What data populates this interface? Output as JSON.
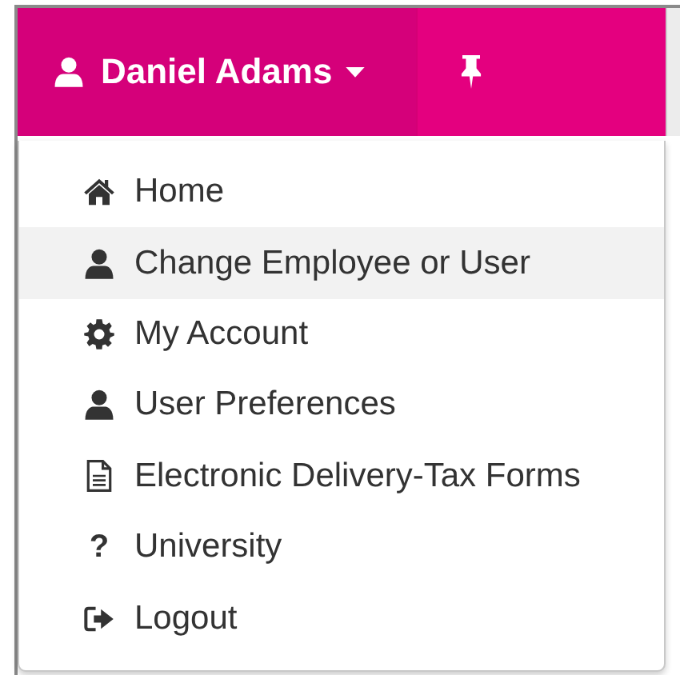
{
  "header": {
    "user_name": "Daniel Adams",
    "menu_open": true,
    "pinned": false
  },
  "menu": [
    {
      "kind": "home",
      "label": "Home",
      "highlighted": false
    },
    {
      "kind": "user",
      "label": "Change Employee or User",
      "highlighted": true
    },
    {
      "kind": "gear",
      "label": "My Account",
      "highlighted": false
    },
    {
      "kind": "user",
      "label": "User Preferences",
      "highlighted": false
    },
    {
      "kind": "document",
      "label": "Electronic Delivery-Tax Forms",
      "highlighted": false
    },
    {
      "kind": "glyph",
      "glyph": "?",
      "label": "University",
      "highlighted": false
    },
    {
      "kind": "logout",
      "label": "Logout",
      "highlighted": false
    }
  ]
}
